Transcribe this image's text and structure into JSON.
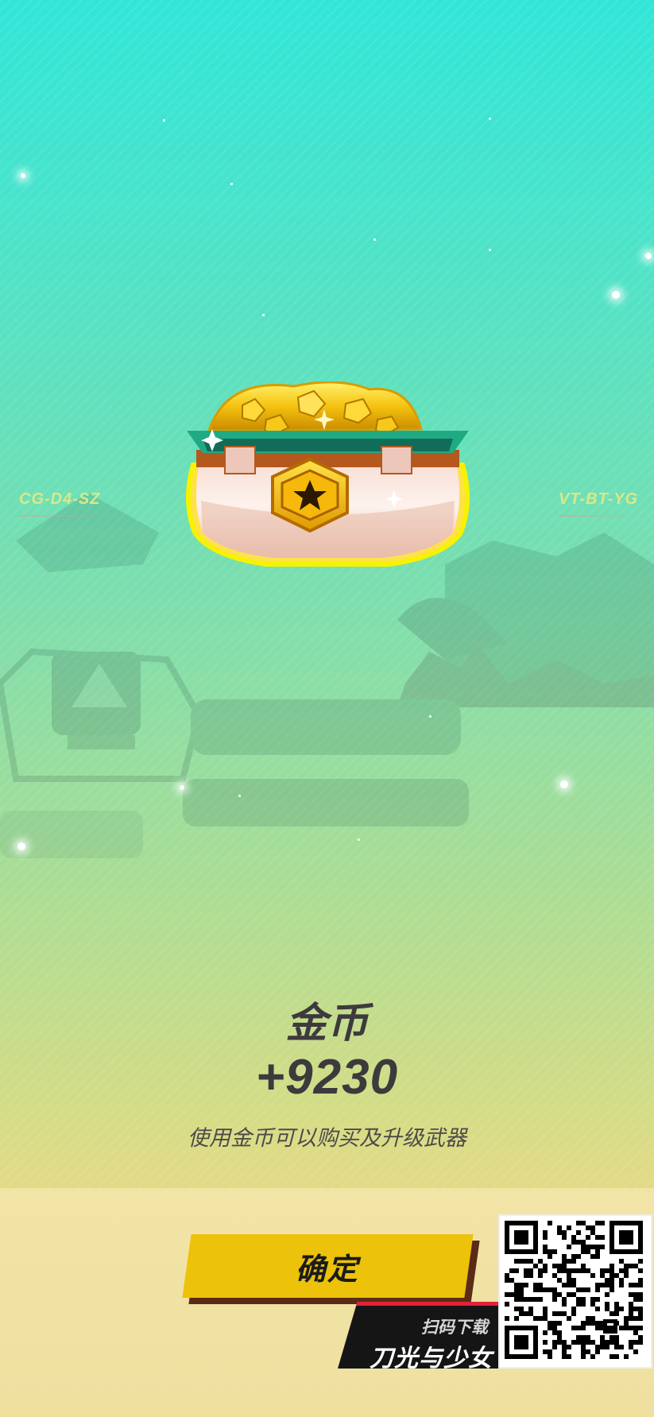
{
  "reward": {
    "title": "金币",
    "amount": "+9230",
    "description": "使用金币可以购买及升级武器"
  },
  "background": {
    "left_code": "CG-D4-SZ",
    "right_code": "VT-BT-YG"
  },
  "actions": {
    "confirm_label": "确定"
  },
  "promo": {
    "scan_label": "扫码下载",
    "game_name": "刀光与少女"
  },
  "colors": {
    "button": "#ecc20a",
    "text": "#3d3a3d",
    "gold": "#f5c20f"
  },
  "icons": {
    "reward_item": "gold-coin-pot-icon",
    "emblem": "star-hexagon-icon",
    "qr": "qr-code-icon"
  }
}
